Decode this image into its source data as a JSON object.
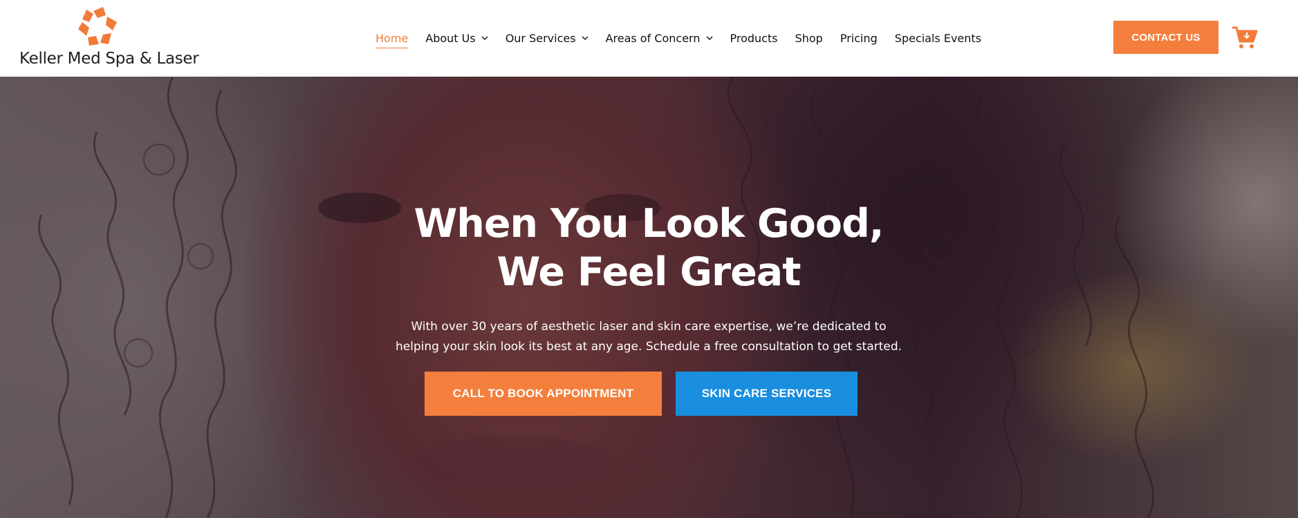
{
  "brand": {
    "name": "Keller Med Spa & Laser",
    "logo_icon": "pinwheel-logo-icon",
    "accent_color": "#f47f3d"
  },
  "nav": {
    "items": [
      {
        "label": "Home",
        "active": true,
        "has_dropdown": false
      },
      {
        "label": "About Us",
        "active": false,
        "has_dropdown": true
      },
      {
        "label": "Our Services",
        "active": false,
        "has_dropdown": true
      },
      {
        "label": "Areas of Concern",
        "active": false,
        "has_dropdown": true
      },
      {
        "label": "Products",
        "active": false,
        "has_dropdown": false
      },
      {
        "label": "Shop",
        "active": false,
        "has_dropdown": false
      },
      {
        "label": "Pricing",
        "active": false,
        "has_dropdown": false
      },
      {
        "label": "Specials Events",
        "active": false,
        "has_dropdown": false
      }
    ],
    "active_color": "#f07e37"
  },
  "header": {
    "contact_label": "CONTACT US",
    "cart_icon": "cart-download-icon"
  },
  "hero": {
    "title_line1": "When You Look Good,",
    "title_line2": "We Feel Great",
    "subtitle_line1": "With over 30 years of aesthetic laser and skin care expertise, we’re dedicated to",
    "subtitle_line2": "helping your skin look its best at any age. Schedule a free consultation to get started.",
    "primary_button": {
      "label": "CALL TO BOOK APPOINTMENT",
      "color": "#f47f3d"
    },
    "secondary_button": {
      "label": "SKIN CARE SERVICES",
      "color": "#1a8ede"
    }
  }
}
